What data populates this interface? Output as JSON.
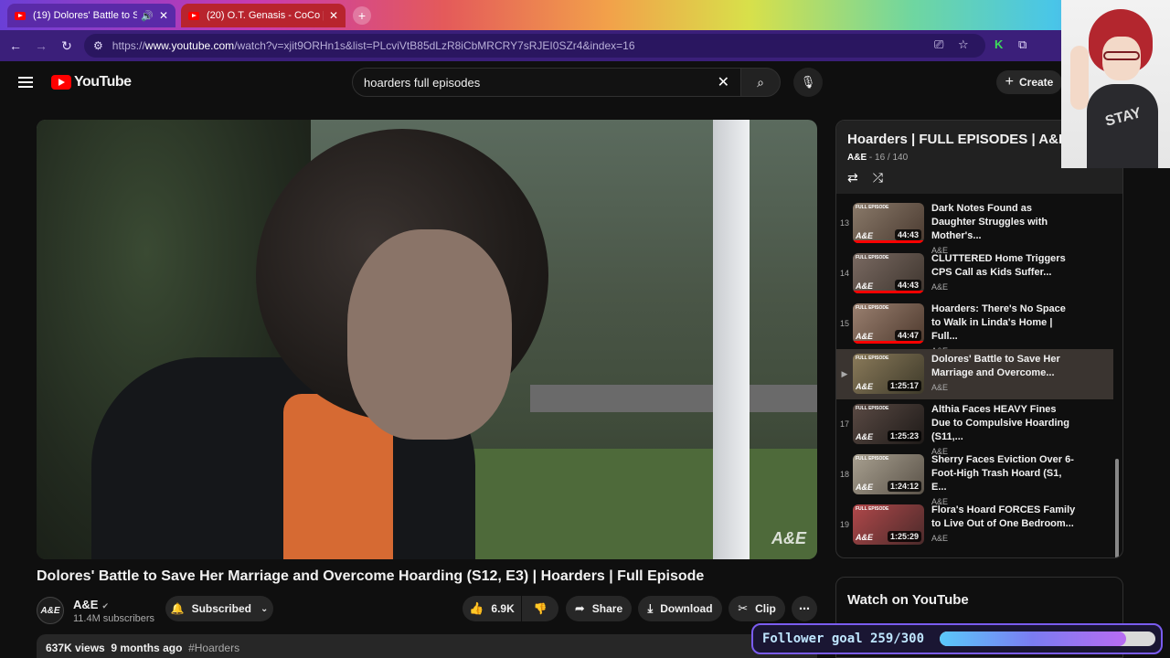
{
  "browser": {
    "tabs": [
      {
        "title": "(19) Dolores' Battle to Save",
        "active": true
      },
      {
        "title": "(20) O.T. Genasis - CoCo [Offici",
        "active": false
      }
    ],
    "url_prefix": "https://",
    "url_host": "www.youtube.com",
    "url_path": "/watch?v=xjit9ORHn1s&list=PLcviVtB85dLzR8iCbMRCRY7sRJEI0SZr4&index=16"
  },
  "header": {
    "logo_text": "YouTube",
    "search_value": "hoarders full episodes",
    "create_label": "Create"
  },
  "video": {
    "title": "Dolores' Battle to Save Her Marriage and Overcome Hoarding (S12, E3) | Hoarders | Full Episode",
    "watermark": "A&E",
    "channel": "A&E",
    "subscribers": "11.4M subscribers",
    "subscribe_label": "Subscribed",
    "likes": "6.9K",
    "share_label": "Share",
    "download_label": "Download",
    "clip_label": "Clip",
    "views": "637K views",
    "age": "9 months ago",
    "hashtag": "#Hoarders"
  },
  "playlist": {
    "title": "Hoarders | FULL EPISODES | A&E",
    "owner": "A&E",
    "position": "- 16 / 140",
    "items": [
      {
        "index": "13",
        "title": "Dark Notes Found as Daughter Struggles with Mother's...",
        "channel": "A&E",
        "duration": "44:43",
        "progress": 1.0
      },
      {
        "index": "14",
        "title": "CLUTTERED Home Triggers CPS Call as Kids Suffer...",
        "channel": "A&E",
        "duration": "44:43",
        "progress": 1.0
      },
      {
        "index": "15",
        "title": "Hoarders: There's No Space to Walk in Linda's Home | Full...",
        "channel": "A&E",
        "duration": "44:47",
        "progress": 1.0
      },
      {
        "index": "▶",
        "title": "Dolores' Battle to Save Her Marriage and Overcome...",
        "channel": "A&E",
        "duration": "1:25:17",
        "progress": 0.0
      },
      {
        "index": "17",
        "title": "Althia Faces HEAVY Fines Due to Compulsive Hoarding (S11,...",
        "channel": "A&E",
        "duration": "1:25:23",
        "progress": 0.0
      },
      {
        "index": "18",
        "title": "Sherry Faces Eviction Over 6-Foot-High Trash Hoard (S1, E...",
        "channel": "A&E",
        "duration": "1:24:12",
        "progress": 0.0
      },
      {
        "index": "19",
        "title": "Flora's Hoard FORCES Family to Live Out of One Bedroom...",
        "channel": "A&E",
        "duration": "1:25:29",
        "progress": 0.0
      }
    ],
    "thumb_label": "FULL EPISODE"
  },
  "watch_on_youtube": "Watch on YouTube",
  "overlay": {
    "follower_text": "Follower goal 259/300",
    "follower_progress": 0.863,
    "shirt_text": "STAY"
  }
}
